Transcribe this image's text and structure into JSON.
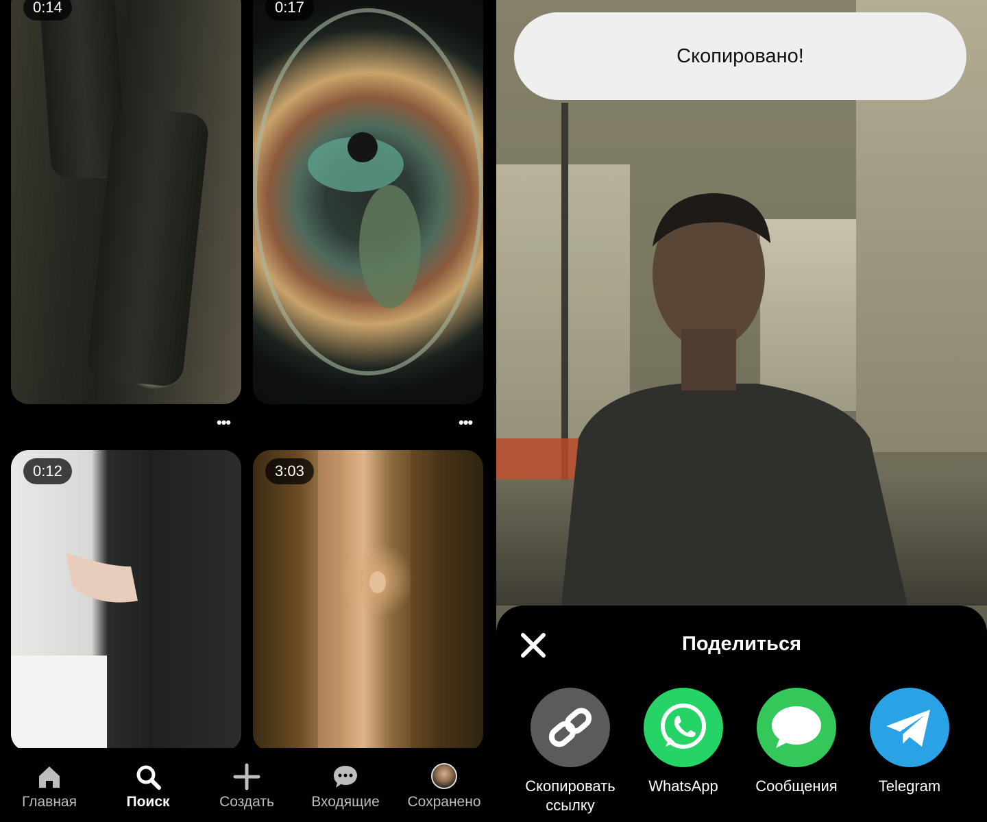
{
  "grid": {
    "cards": [
      {
        "duration": "0:14"
      },
      {
        "duration": "0:17"
      },
      {
        "duration": "0:12"
      },
      {
        "duration": "3:03"
      }
    ],
    "more_label": "•••"
  },
  "nav": {
    "items": [
      {
        "label": "Главная",
        "icon": "home-icon"
      },
      {
        "label": "Поиск",
        "icon": "search-icon",
        "active": true
      },
      {
        "label": "Создать",
        "icon": "plus-icon"
      },
      {
        "label": "Входящие",
        "icon": "chat-icon"
      },
      {
        "label": "Сохранено",
        "icon": "avatar"
      }
    ]
  },
  "toast": {
    "text": "Скопировано!"
  },
  "share_sheet": {
    "title": "Поделиться",
    "options": [
      {
        "label": "Скопировать ссылку",
        "icon": "link-icon",
        "color": "#5b5b5b"
      },
      {
        "label": "WhatsApp",
        "icon": "whatsapp-icon",
        "color": "#25d366"
      },
      {
        "label": "Сообщения",
        "icon": "messages-icon",
        "color": "#34c759"
      },
      {
        "label": "Telegram",
        "icon": "telegram-icon",
        "color": "#2aa3e6"
      }
    ]
  }
}
